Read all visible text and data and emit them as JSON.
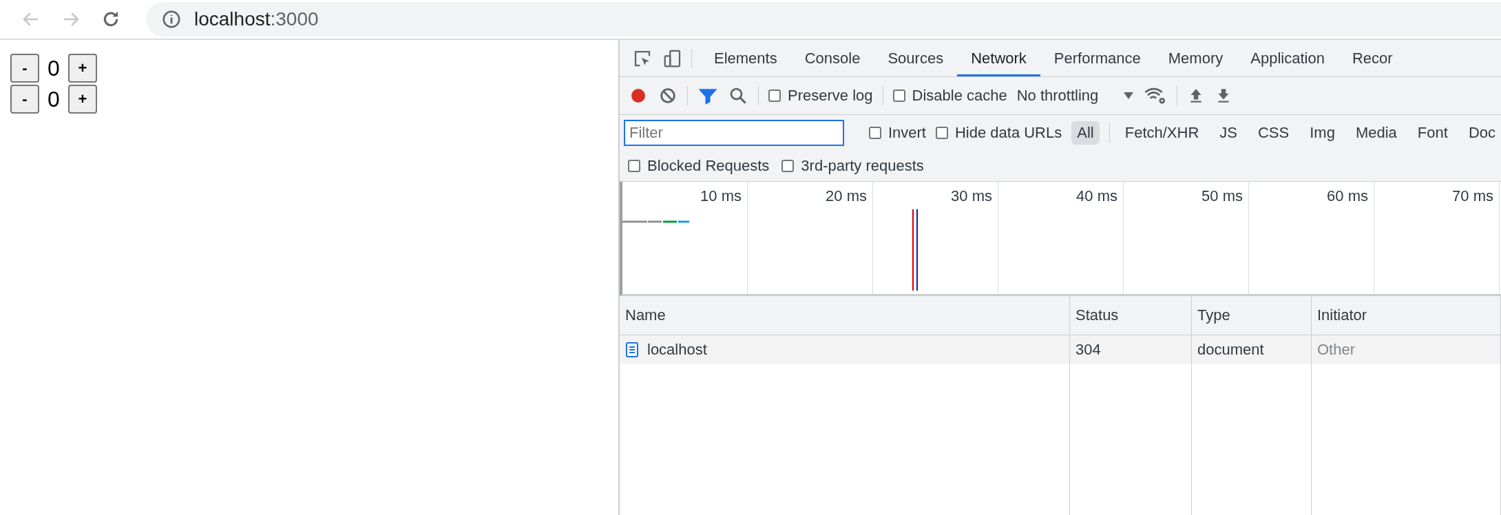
{
  "browser": {
    "address_host": "localhost",
    "address_port": ":3000"
  },
  "page": {
    "counters": [
      {
        "decrement": "-",
        "value": "0",
        "increment": "+"
      },
      {
        "decrement": "-",
        "value": "0",
        "increment": "+"
      }
    ]
  },
  "devtools": {
    "tabs": [
      {
        "label": "Elements",
        "selected": false
      },
      {
        "label": "Console",
        "selected": false
      },
      {
        "label": "Sources",
        "selected": false
      },
      {
        "label": "Network",
        "selected": true
      },
      {
        "label": "Performance",
        "selected": false
      },
      {
        "label": "Memory",
        "selected": false
      },
      {
        "label": "Application",
        "selected": false
      },
      {
        "label": "Recor",
        "selected": false
      }
    ],
    "toolbar": {
      "recording": true,
      "filter_active": true,
      "preserve_log": {
        "label": "Preserve log",
        "checked": false
      },
      "disable_cache": {
        "label": "Disable cache",
        "checked": false
      },
      "throttling": "No throttling"
    },
    "filter": {
      "placeholder": "Filter",
      "invert": {
        "label": "Invert",
        "checked": false
      },
      "hide_data_urls": {
        "label": "Hide data URLs",
        "checked": false
      },
      "types": [
        {
          "label": "All",
          "selected": true
        },
        {
          "label": "Fetch/XHR",
          "selected": false
        },
        {
          "label": "JS",
          "selected": false
        },
        {
          "label": "CSS",
          "selected": false
        },
        {
          "label": "Img",
          "selected": false
        },
        {
          "label": "Media",
          "selected": false
        },
        {
          "label": "Font",
          "selected": false
        },
        {
          "label": "Doc",
          "selected": false
        }
      ],
      "blocked_requests": {
        "label": "Blocked Requests",
        "checked": false
      },
      "third_party": {
        "label": "3rd-party requests",
        "checked": false
      }
    },
    "timeline": {
      "ticks": [
        "10 ms",
        "20 ms",
        "30 ms",
        "40 ms",
        "50 ms",
        "60 ms",
        "70 ms"
      ]
    },
    "table": {
      "columns": [
        "Name",
        "Status",
        "Type",
        "Initiator"
      ],
      "rows": [
        {
          "name": "localhost",
          "status": "304",
          "type": "document",
          "initiator": "Other"
        }
      ]
    }
  }
}
